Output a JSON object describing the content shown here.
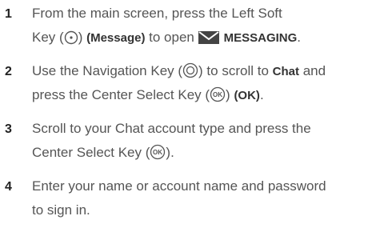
{
  "steps": [
    {
      "number": "1",
      "line1": {
        "before": "From the main screen, press the Left Soft"
      },
      "line2": {
        "before": "Key (",
        "icon": "left-soft-key-icon",
        "after": ") ",
        "bold1": "(Message)",
        "middle": " to open ",
        "icon2": "messaging-envelope-icon",
        "bold2": "MESSAGING",
        "end": "."
      }
    },
    {
      "number": "2",
      "line1": {
        "before": "Use the Navigation Key (",
        "icon": "navigation-key-icon",
        "after": ") to scroll to ",
        "bold": "Chat",
        "end": " and"
      },
      "line2": {
        "before": "press the Center Select Key (",
        "icon": "center-select-ok-icon",
        "after": ") ",
        "bold": "(OK)",
        "end": "."
      }
    },
    {
      "number": "3",
      "line1": {
        "before": "Scroll to your Chat account type and press the"
      },
      "line2": {
        "before": "Center Select Key (",
        "icon": "center-select-ok-icon",
        "after": ")."
      }
    },
    {
      "number": "4",
      "line1": {
        "before": "Enter your name or account name and password"
      },
      "line2": {
        "before": "to sign in."
      }
    }
  ],
  "icon_labels": {
    "ok": "OK"
  },
  "colors": {
    "text": "#555555",
    "number": "#222222",
    "bold": "#333333",
    "icon_stroke": "#555555",
    "envelope": "#444444"
  }
}
